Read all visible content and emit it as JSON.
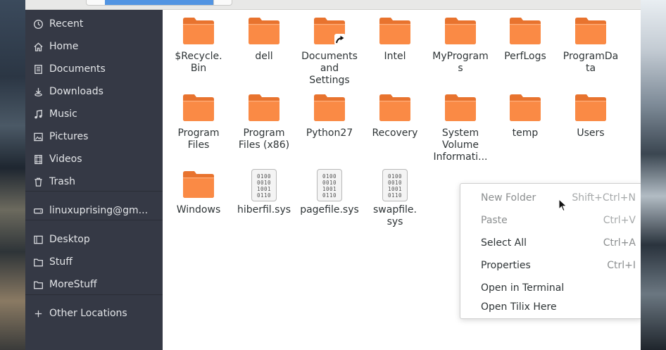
{
  "colors": {
    "sidebar_bg": "#353945",
    "folder_orange": "#fa8a45",
    "accent": "#5294e2",
    "menu_disabled": "#8b8e8f"
  },
  "sidebar": {
    "items": [
      {
        "label": "Recent",
        "icon": "clock-icon"
      },
      {
        "label": "Home",
        "icon": "home-icon"
      },
      {
        "label": "Documents",
        "icon": "document-icon"
      },
      {
        "label": "Downloads",
        "icon": "download-icon"
      },
      {
        "label": "Music",
        "icon": "music-icon"
      },
      {
        "label": "Pictures",
        "icon": "picture-icon"
      },
      {
        "label": "Videos",
        "icon": "film-icon"
      },
      {
        "label": "Trash",
        "icon": "trash-icon"
      },
      {
        "label": "linuxuprising@gm...",
        "icon": "network-drive-icon"
      },
      {
        "label": "Desktop",
        "icon": "desktop-icon"
      },
      {
        "label": "Stuff",
        "icon": "folder-icon"
      },
      {
        "label": "MoreStuff",
        "icon": "folder-icon"
      },
      {
        "label": "Other Locations",
        "icon": "plus-icon"
      }
    ]
  },
  "files": [
    {
      "name": "$Recycle.\nBin",
      "type": "folder"
    },
    {
      "name": "dell",
      "type": "folder"
    },
    {
      "name": "Documents\nand\nSettings",
      "type": "folder-link"
    },
    {
      "name": "Intel",
      "type": "folder"
    },
    {
      "name": "MyProgram\ns",
      "type": "folder"
    },
    {
      "name": "PerfLogs",
      "type": "folder"
    },
    {
      "name": "ProgramDa\nta",
      "type": "folder"
    },
    {
      "name": "Program\nFiles",
      "type": "folder"
    },
    {
      "name": "Program\nFiles (x86)",
      "type": "folder"
    },
    {
      "name": "Python27",
      "type": "folder"
    },
    {
      "name": "Recovery",
      "type": "folder"
    },
    {
      "name": "System\nVolume\nInformati...",
      "type": "folder"
    },
    {
      "name": "temp",
      "type": "folder"
    },
    {
      "name": "Users",
      "type": "folder"
    },
    {
      "name": "Windows",
      "type": "folder"
    },
    {
      "name": "hiberfil.sys",
      "type": "file"
    },
    {
      "name": "pagefile.sys",
      "type": "file"
    },
    {
      "name": "swapfile.\nsys",
      "type": "file"
    }
  ],
  "file_icon_text": [
    "0100",
    "0010",
    "1001",
    "0110"
  ],
  "context_menu": {
    "items": [
      {
        "label": "New Folder",
        "shortcut": "Shift+Ctrl+N",
        "disabled": true
      },
      {
        "label": "Paste",
        "shortcut": "Ctrl+V",
        "disabled": true
      },
      {
        "label": "Select All",
        "shortcut": "Ctrl+A",
        "disabled": false
      },
      {
        "label": "Properties",
        "shortcut": "Ctrl+I",
        "disabled": false
      },
      {
        "label": "Open in Terminal",
        "shortcut": "",
        "disabled": false
      },
      {
        "label": "Open Tilix Here",
        "shortcut": "",
        "disabled": false
      }
    ]
  }
}
